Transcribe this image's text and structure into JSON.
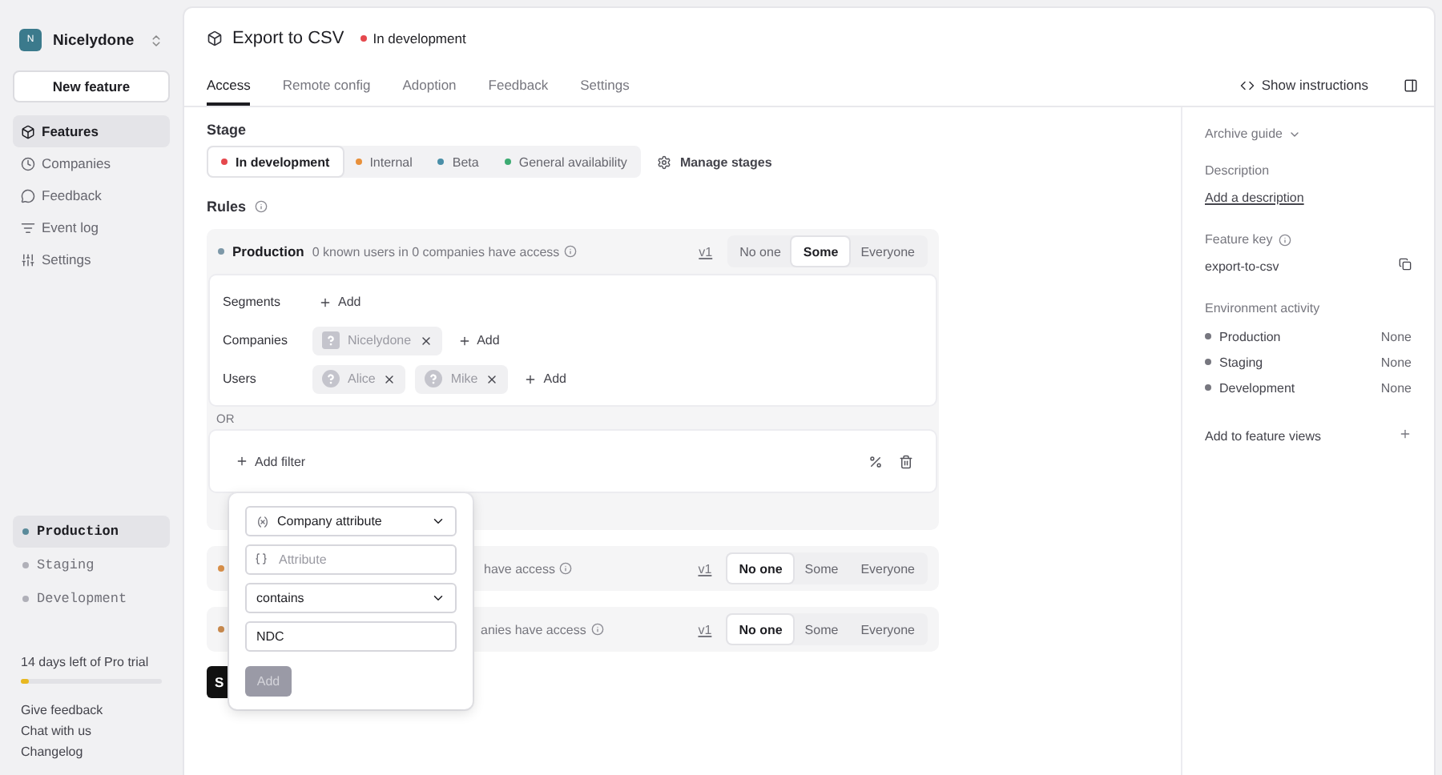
{
  "sidebar": {
    "org": {
      "initial": "N",
      "name": "Nicelydone"
    },
    "new_button": "New feature",
    "nav": [
      {
        "label": "Features",
        "selected": true
      },
      {
        "label": "Companies",
        "selected": false
      },
      {
        "label": "Feedback",
        "selected": false
      },
      {
        "label": "Event log",
        "selected": false
      },
      {
        "label": "Settings",
        "selected": false
      }
    ],
    "environments": [
      {
        "label": "Production",
        "selected": true
      },
      {
        "label": "Staging",
        "selected": false
      },
      {
        "label": "Development",
        "selected": false
      }
    ],
    "trial": {
      "text": "14 days left of Pro trial",
      "level": 0.06
    },
    "links": [
      "Give feedback",
      "Chat with us",
      "Changelog"
    ]
  },
  "header": {
    "title": "Export to CSV",
    "status": {
      "label": "In development",
      "color": "#e5484d"
    },
    "tabs": [
      {
        "label": "Access",
        "selected": true
      },
      {
        "label": "Remote config",
        "selected": false
      },
      {
        "label": "Adoption",
        "selected": false
      },
      {
        "label": "Feedback",
        "selected": false
      },
      {
        "label": "Settings",
        "selected": false
      }
    ],
    "show_instructions": "Show instructions"
  },
  "stage": {
    "label": "Stage",
    "options": [
      {
        "label": "In development",
        "color": "#e5484d",
        "selected": true
      },
      {
        "label": "Internal",
        "color": "#e8903a",
        "selected": false
      },
      {
        "label": "Beta",
        "color": "#4a8fa8",
        "selected": false
      },
      {
        "label": "General availability",
        "color": "#3dab72",
        "selected": false
      }
    ],
    "manage": "Manage stages"
  },
  "rules": {
    "label": "Rules",
    "environments": [
      {
        "name": "Production",
        "color": "#7d98a8",
        "summary": "0 known users in 0 companies have access",
        "version": "v1",
        "options": [
          {
            "label": "No one",
            "selected": false
          },
          {
            "label": "Some",
            "selected": true
          },
          {
            "label": "Everyone",
            "selected": false
          }
        ],
        "targets": [
          {
            "label": "Segments",
            "add": "Add"
          },
          {
            "label": "Companies",
            "chips": [
              {
                "name": "Nicelydone",
                "kind": "company"
              }
            ],
            "add": "Add"
          },
          {
            "label": "Users",
            "chips": [
              {
                "name": "Alice",
                "kind": "user"
              },
              {
                "name": "Mike",
                "kind": "user"
              }
            ],
            "add": "Add"
          }
        ],
        "or": "OR",
        "add_filter": "Add filter"
      },
      {
        "color": "#d9904a",
        "summary": "have access",
        "version": "v1",
        "options": [
          {
            "label": "No one",
            "selected": true
          },
          {
            "label": "Some",
            "selected": false
          },
          {
            "label": "Everyone",
            "selected": false
          }
        ]
      },
      {
        "color": "#c98a4e",
        "summary": "anies have access",
        "version": "v1",
        "options": [
          {
            "label": "No one",
            "selected": true
          },
          {
            "label": "Some",
            "selected": false
          },
          {
            "label": "Everyone",
            "selected": false
          }
        ]
      }
    ],
    "save_button": "S"
  },
  "filter_popover": {
    "type_select": "Company attribute",
    "attribute": {
      "placeholder": "Attribute"
    },
    "operator_select": "contains",
    "value": "NDC",
    "add_button": {
      "label": "Add",
      "disabled": true
    }
  },
  "details": {
    "archive_guide": "Archive guide",
    "description_label": "Description",
    "description_link": "Add a description",
    "key_label": "Feature key",
    "key": "export-to-csv",
    "activity_label": "Environment activity",
    "activity": [
      {
        "name": "Production",
        "value": "None"
      },
      {
        "name": "Staging",
        "value": "None"
      },
      {
        "name": "Development",
        "value": "None"
      }
    ],
    "feature_views": "Add to feature views"
  }
}
